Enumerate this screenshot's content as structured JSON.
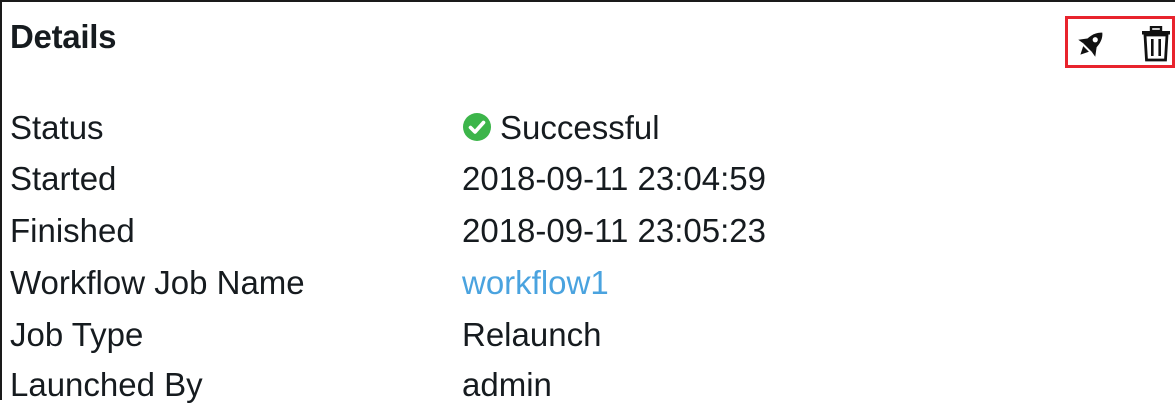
{
  "panel": {
    "title": "Details",
    "actions": {
      "launch_icon": "rocket-icon",
      "delete_icon": "trash-icon",
      "highlight_color": "#e8232d"
    }
  },
  "details": [
    {
      "label": "Status",
      "value": "Successful",
      "icon": "check-circle-icon",
      "icon_color": "#3cb54a"
    },
    {
      "label": "Started",
      "value": "2018-09-11 23:04:59"
    },
    {
      "label": "Finished",
      "value": "2018-09-11 23:05:23"
    },
    {
      "label": "Workflow Job Name",
      "value": "workflow1",
      "link_color": "#4aa3df"
    },
    {
      "label": "Job Type",
      "value": "Relaunch"
    },
    {
      "label": "Launched By",
      "value": "admin"
    }
  ]
}
